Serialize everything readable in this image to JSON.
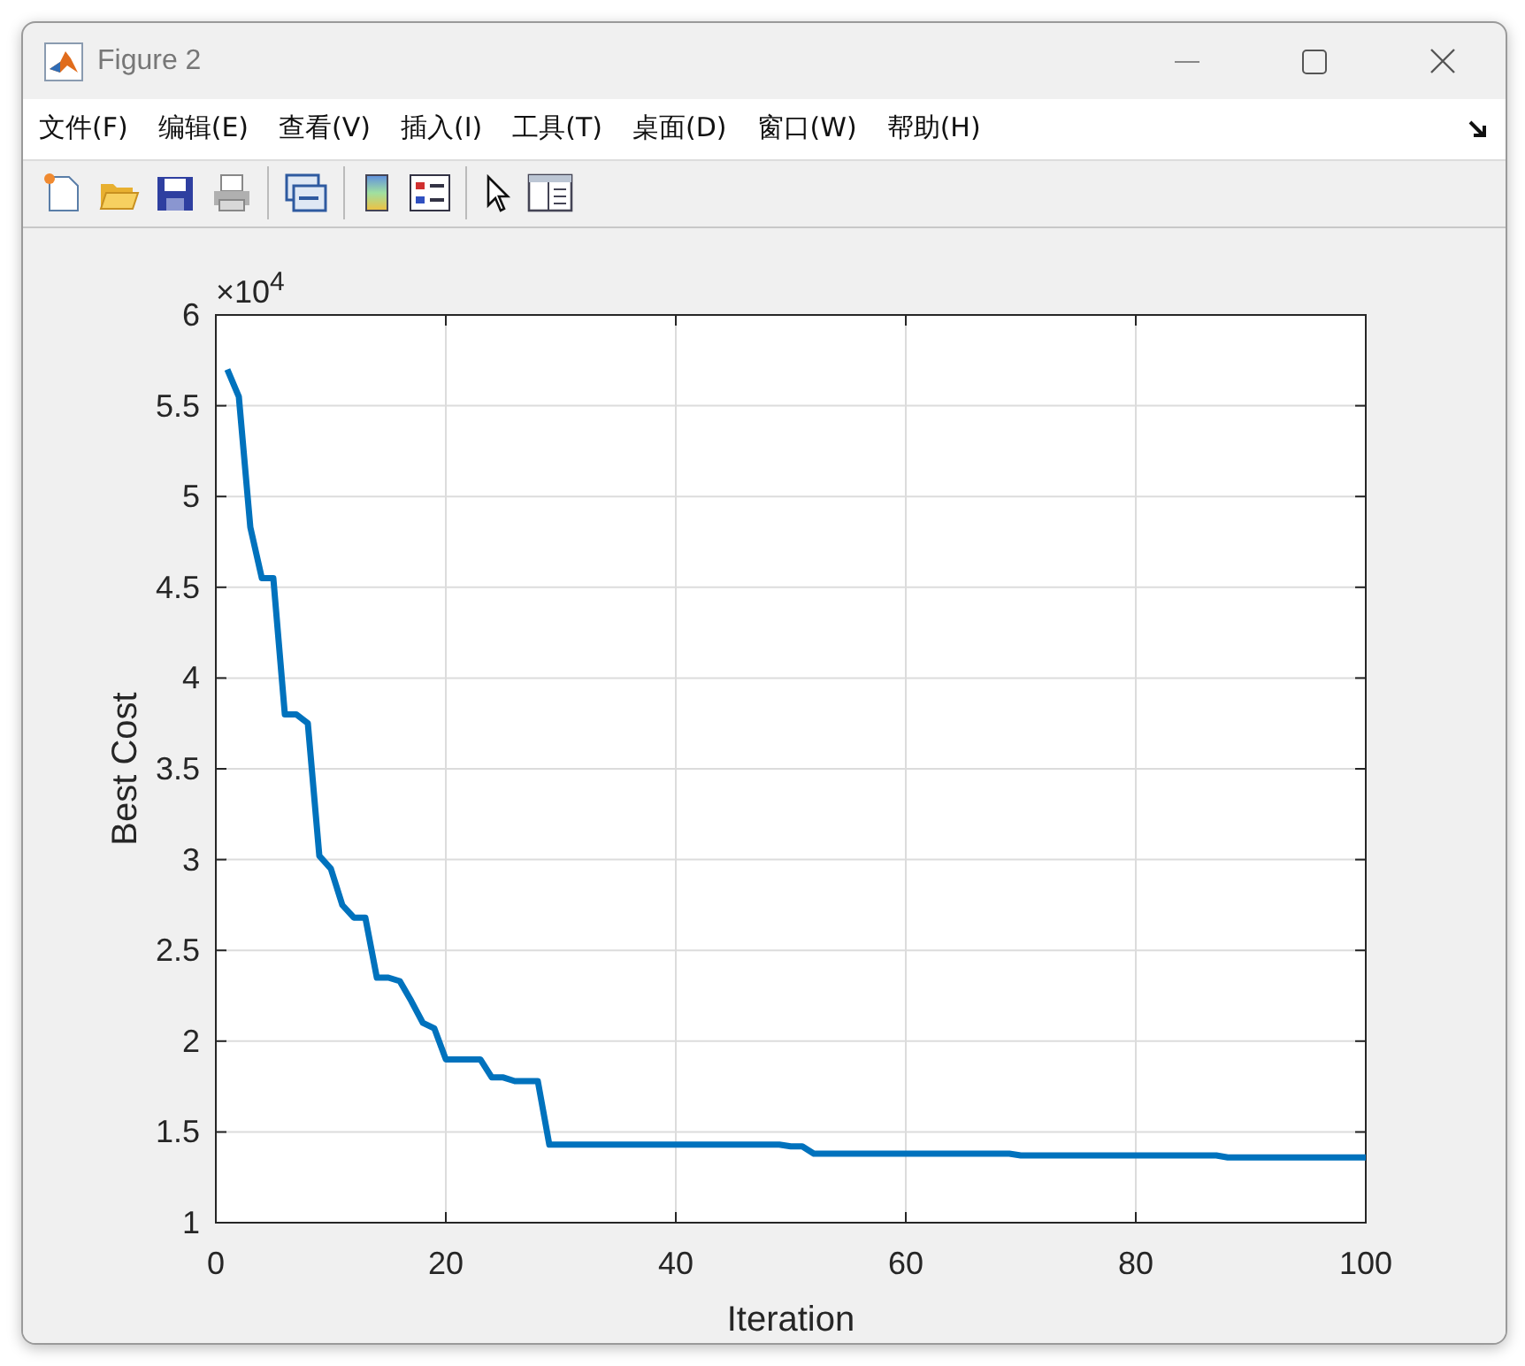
{
  "window": {
    "title": "Figure 2"
  },
  "menu": [
    "文件(F)",
    "编辑(E)",
    "查看(V)",
    "插入(I)",
    "工具(T)",
    "桌面(D)",
    "窗口(W)",
    "帮助(H)"
  ],
  "plot": {
    "exponent_label": "×10$^{4}$",
    "chart_data": {
      "type": "line",
      "grid": true,
      "xlabel": "Iteration",
      "ylabel": "Best Cost",
      "xlim": [
        0,
        100
      ],
      "ylim": [
        1,
        6
      ],
      "xticks": [
        0,
        20,
        40,
        60,
        80,
        100
      ],
      "yticks": [
        1,
        1.5,
        2,
        2.5,
        3,
        3.5,
        4,
        4.5,
        5,
        5.5,
        6
      ],
      "x": [
        1,
        2,
        3,
        4,
        5,
        6,
        7,
        8,
        9,
        10,
        11,
        12,
        13,
        14,
        15,
        16,
        17,
        18,
        19,
        20,
        21,
        22,
        23,
        24,
        25,
        26,
        27,
        28,
        29,
        30,
        31,
        32,
        33,
        34,
        35,
        36,
        37,
        38,
        39,
        40,
        41,
        42,
        43,
        44,
        45,
        46,
        47,
        48,
        49,
        50,
        51,
        52,
        53,
        54,
        55,
        56,
        57,
        58,
        59,
        60,
        61,
        62,
        63,
        64,
        65,
        66,
        67,
        68,
        69,
        70,
        71,
        72,
        73,
        74,
        75,
        76,
        77,
        78,
        79,
        80,
        81,
        82,
        83,
        84,
        85,
        86,
        87,
        88,
        89,
        90,
        91,
        92,
        93,
        94,
        95,
        96,
        97,
        98,
        99,
        100
      ],
      "series": [
        {
          "color": "#0072bd",
          "values": [
            5.7,
            5.55,
            4.83,
            4.55,
            4.55,
            3.8,
            3.8,
            3.75,
            3.02,
            2.95,
            2.75,
            2.68,
            2.68,
            2.35,
            2.35,
            2.33,
            2.22,
            2.1,
            2.07,
            1.9,
            1.9,
            1.9,
            1.9,
            1.8,
            1.8,
            1.78,
            1.78,
            1.78,
            1.43,
            1.43,
            1.43,
            1.43,
            1.43,
            1.43,
            1.43,
            1.43,
            1.43,
            1.43,
            1.43,
            1.43,
            1.43,
            1.43,
            1.43,
            1.43,
            1.43,
            1.43,
            1.43,
            1.43,
            1.43,
            1.42,
            1.42,
            1.38,
            1.38,
            1.38,
            1.38,
            1.38,
            1.38,
            1.38,
            1.38,
            1.38,
            1.38,
            1.38,
            1.38,
            1.38,
            1.38,
            1.38,
            1.38,
            1.38,
            1.38,
            1.37,
            1.37,
            1.37,
            1.37,
            1.37,
            1.37,
            1.37,
            1.37,
            1.37,
            1.37,
            1.37,
            1.37,
            1.37,
            1.37,
            1.37,
            1.37,
            1.37,
            1.37,
            1.36,
            1.36,
            1.36,
            1.36,
            1.36,
            1.36,
            1.36,
            1.36,
            1.36,
            1.36,
            1.36,
            1.36,
            1.36
          ]
        }
      ]
    }
  }
}
